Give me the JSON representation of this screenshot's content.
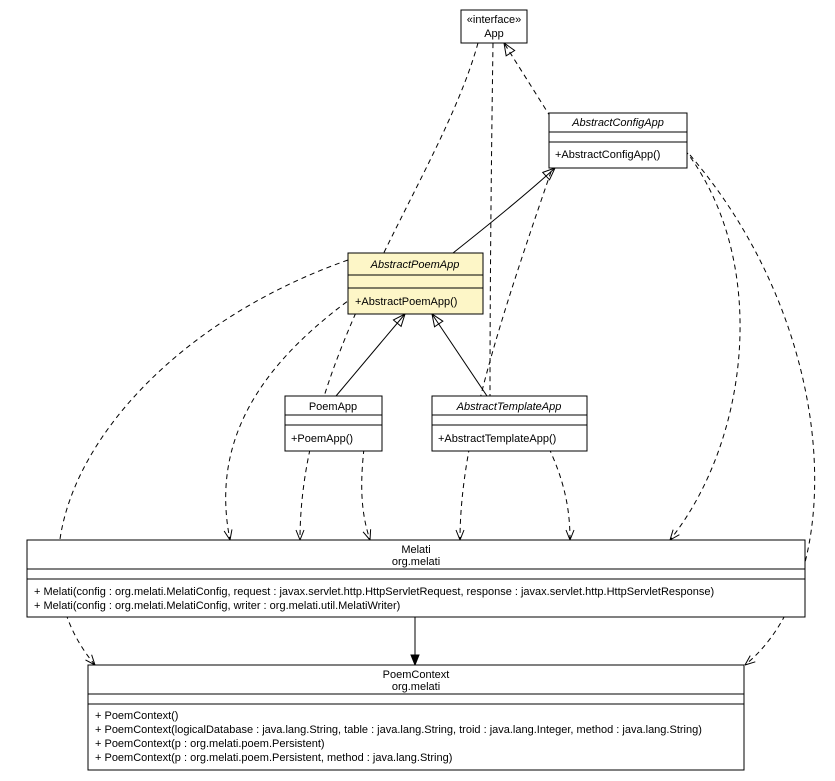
{
  "interface": {
    "stereotype": "«interface»",
    "name": "App"
  },
  "abstractConfigApp": {
    "name": "AbstractConfigApp",
    "ctor": "+AbstractConfigApp()"
  },
  "abstractPoemApp": {
    "name": "AbstractPoemApp",
    "ctor": "+AbstractPoemApp()"
  },
  "poemApp": {
    "name": "PoemApp",
    "ctor": "+PoemApp()"
  },
  "abstractTemplateApp": {
    "name": "AbstractTemplateApp",
    "ctor": "+AbstractTemplateApp()"
  },
  "melati": {
    "name": "Melati",
    "pkg": "org.melati",
    "m1": "+ Melati(config : org.melati.MelatiConfig, request : javax.servlet.http.HttpServletRequest, response : javax.servlet.http.HttpServletResponse)",
    "m2": "+ Melati(config : org.melati.MelatiConfig, writer : org.melati.util.MelatiWriter)"
  },
  "poemContext": {
    "name": "PoemContext",
    "pkg": "org.melati",
    "m1": "+ PoemContext()",
    "m2": "+ PoemContext(logicalDatabase : java.lang.String, table : java.lang.String, troid : java.lang.Integer, method : java.lang.String)",
    "m3": "+ PoemContext(p : org.melati.poem.Persistent)",
    "m4": "+ PoemContext(p : org.melati.poem.Persistent, method : java.lang.String)"
  }
}
